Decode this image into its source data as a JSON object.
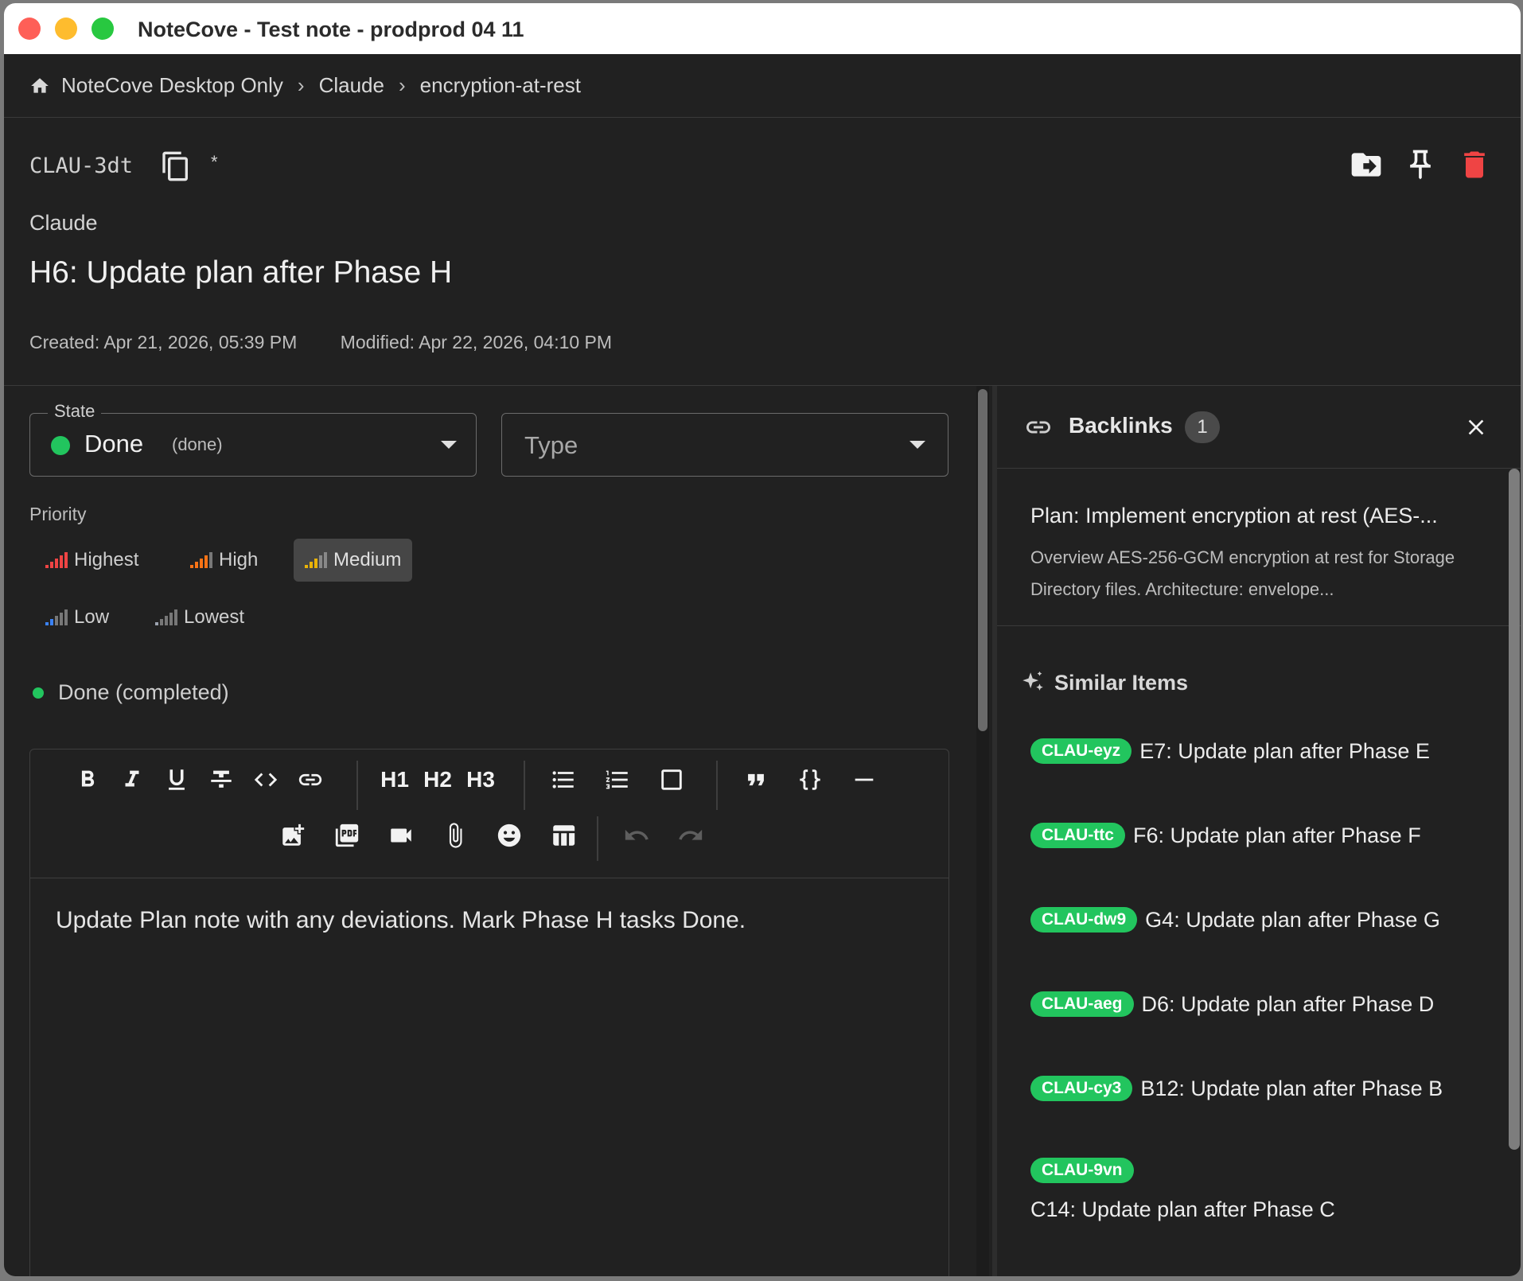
{
  "window": {
    "title": "NoteCove - Test note - prodprod 04 11"
  },
  "breadcrumb": {
    "items": [
      "NoteCove Desktop Only",
      "Claude",
      "encryption-at-rest"
    ]
  },
  "note": {
    "id": "CLAU-3dt",
    "dirty_marker": "*",
    "folder": "Claude",
    "title": "H6: Update plan after Phase H",
    "created": "Created: Apr 21, 2026, 05:39 PM",
    "modified": "Modified: Apr 22, 2026, 04:10 PM"
  },
  "state": {
    "legend": "State",
    "value": "Done",
    "key": "(done)",
    "color": "#22c55e"
  },
  "type": {
    "placeholder": "Type"
  },
  "priority": {
    "label": "Priority",
    "options": [
      {
        "label": "Highest",
        "color": "#ef4444",
        "selected": false
      },
      {
        "label": "High",
        "color": "#f97316",
        "selected": false
      },
      {
        "label": "Medium",
        "color": "#eab308",
        "selected": true
      },
      {
        "label": "Low",
        "color": "#3b82f6",
        "selected": false
      },
      {
        "label": "Lowest",
        "color": "#9ca3af",
        "selected": false
      }
    ]
  },
  "status_line": "Done (completed)",
  "toolbar": {
    "h1": "H1",
    "h2": "H2",
    "h3": "H3"
  },
  "editor": {
    "content": "Update Plan note with any deviations. Mark Phase H tasks Done."
  },
  "backlinks": {
    "title": "Backlinks",
    "count": "1",
    "items": [
      {
        "title": "Plan: Implement encryption at rest (AES-...",
        "snippet": "Overview AES-256-GCM encryption at rest for Storage Directory files. Architecture: envelope..."
      }
    ]
  },
  "similar": {
    "title": "Similar Items",
    "items": [
      {
        "id": "CLAU-eyz",
        "title": "E7: Update plan after Phase E"
      },
      {
        "id": "CLAU-ttc",
        "title": "F6: Update plan after Phase F"
      },
      {
        "id": "CLAU-dw9",
        "title": "G4: Update plan after Phase G"
      },
      {
        "id": "CLAU-aeg",
        "title": "D6: Update plan after Phase D"
      },
      {
        "id": "CLAU-cy3",
        "title": "B12: Update plan after Phase B"
      },
      {
        "id": "CLAU-9vn",
        "title": "C14: Update plan after Phase C"
      }
    ]
  },
  "colors": {
    "accent_green": "#22c55e",
    "danger": "#ef4444",
    "background": "#212121"
  }
}
